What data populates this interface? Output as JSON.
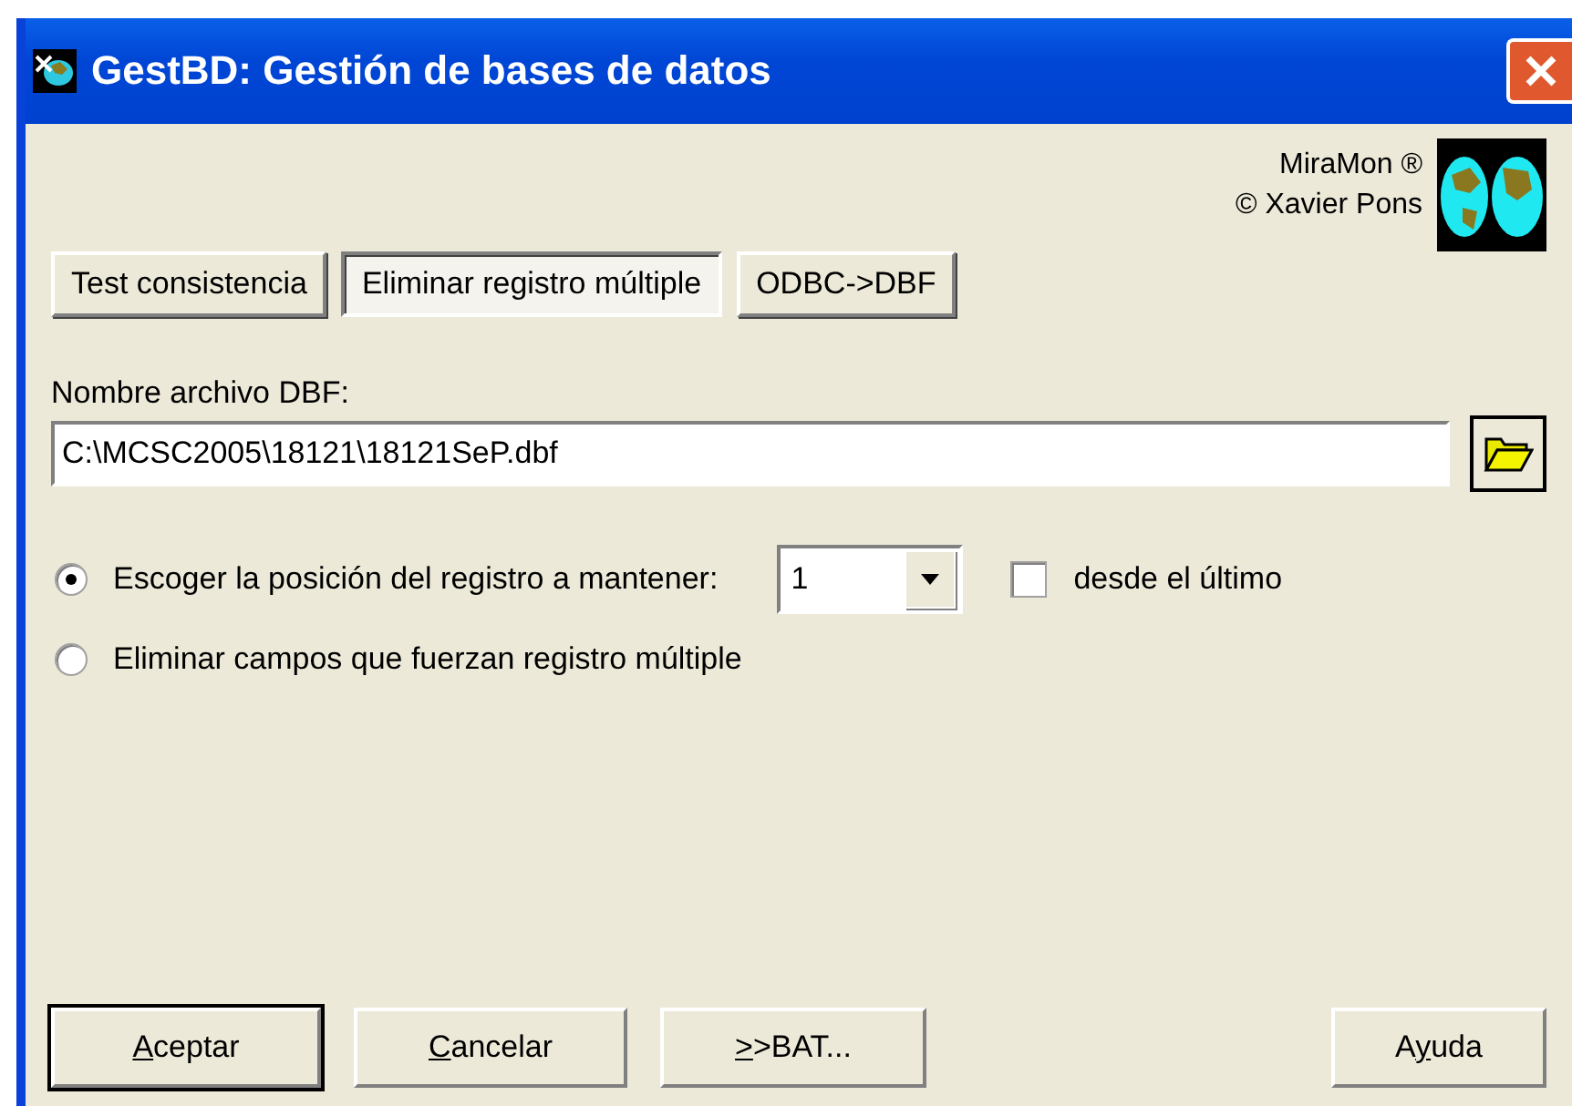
{
  "window": {
    "title": "GestBD: Gestión de bases de datos"
  },
  "credits": {
    "line_1": "MiraMon ®",
    "line_2": "© Xavier Pons"
  },
  "tabs": [
    {
      "label": "Test consistencia",
      "selected": false
    },
    {
      "label": "Eliminar registro múltiple",
      "selected": true
    },
    {
      "label": "ODBC->DBF",
      "selected": false
    }
  ],
  "file": {
    "label": "Nombre archivo DBF:",
    "value": "C:\\MCSC2005\\18121\\18121SeP.dbf"
  },
  "options": [
    {
      "label": "Escoger la posición del registro a mantener:",
      "selected": true,
      "kind": "position"
    },
    {
      "label": "Eliminar campos que fuerzan registro múltiple",
      "selected": false,
      "kind": "plain"
    }
  ],
  "position": {
    "value": "1"
  },
  "from_last": {
    "label": "desde el último",
    "checked": false
  },
  "buttons": [
    {
      "key": "A",
      "after": "ceptar",
      "default": true
    },
    {
      "key": "C",
      "after": "ancelar",
      "default": false
    },
    {
      "key": ">",
      "after": ">BAT...",
      "default": false
    }
  ],
  "help_button": {
    "before": "A",
    "key": "y",
    "after": "uda"
  }
}
